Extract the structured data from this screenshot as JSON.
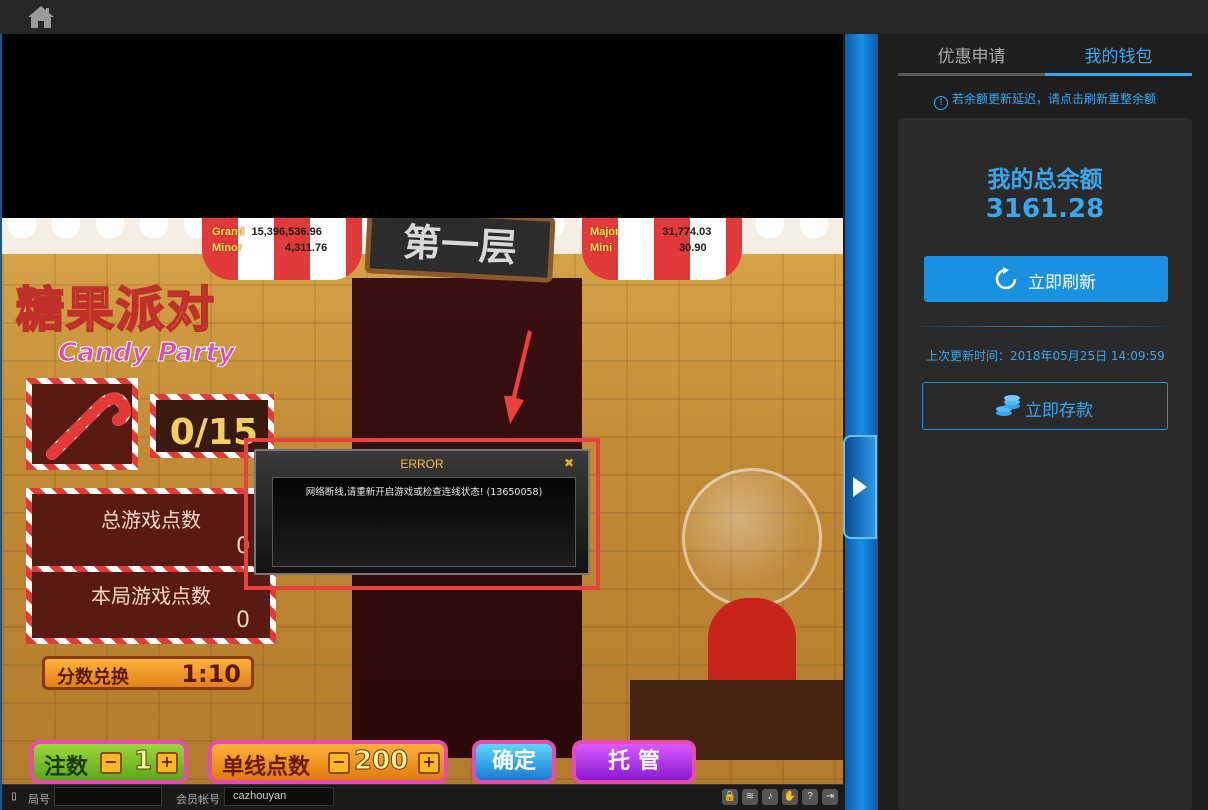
{
  "game": {
    "jackpots": {
      "grand_label": "Grand",
      "grand_value": "15,396,536.96",
      "minor_label": "Minor",
      "minor_value": "4,311.76",
      "major_label": "Major",
      "major_value": "31,774.03",
      "mini_label": "Mini",
      "mini_value": "30.90"
    },
    "floor_sign": "第一层",
    "logo_cn": "糖果派对",
    "logo_en": "Candy Party",
    "counter": "0/15",
    "total_points_label": "总游戏点数",
    "total_points_value": "0",
    "round_points_label": "本局游戏点数",
    "round_points_value": "0",
    "exchange_label": "分数兑换",
    "exchange_value": "1:10",
    "bets_label": "注数",
    "bets_value": "1",
    "line_points_label": "单线点数",
    "line_points_value": "200",
    "confirm_label": "确定",
    "auto_label": "托 管",
    "minus_symbol": "−",
    "plus_symbol": "+"
  },
  "error_dialog": {
    "title": "ERROR",
    "message": "网络断线,请重新开启游戏或检查连线状态! (13650058)"
  },
  "statusbar": {
    "round_label": "局号",
    "round_value": "",
    "member_label": "会员帐号",
    "member_value": "cazhouyan"
  },
  "panel": {
    "tabs": [
      {
        "label": "优惠申请",
        "active": false
      },
      {
        "label": "我的钱包",
        "active": true
      }
    ],
    "notice": "若余额更新延迟，请点击刷新重整余额",
    "balance_title": "我的总余额",
    "balance_amount": "3161.28",
    "refresh_label": "立即刷新",
    "last_update": "上次更新时间：2018年05月25日 14:09:59",
    "deposit_label": "立即存款"
  },
  "colors": {
    "accent": "#37a8f0",
    "button_blue": "#1a90e0",
    "highlight_red": "#e8413e"
  }
}
